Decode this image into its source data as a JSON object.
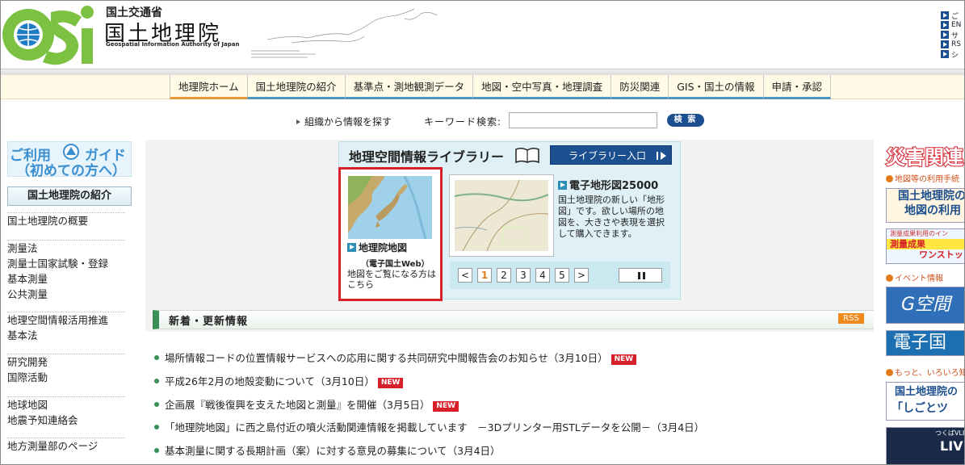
{
  "header": {
    "ministry": "国土交通省",
    "org_name": "国土地理院",
    "org_name_en": "Geospatial Information Authority of Japan",
    "logo_text": "GSI",
    "top_links": [
      "ご",
      "EN",
      "サ",
      "RS",
      "シ"
    ]
  },
  "gnav": {
    "items": [
      "地理院ホーム",
      "国土地理院の紹介",
      "基準点・測地観測データ",
      "地図・空中写真・地理調査",
      "防災関連",
      "GIS・国土の情報",
      "申請・承認"
    ]
  },
  "search": {
    "org_link": "組織から情報を探す",
    "keyword_label": "キーワード検索:",
    "keyword_value": "",
    "button": "検 索"
  },
  "sidebar": {
    "guide_line1_left": "ご利用",
    "guide_line1_right": "ガイド",
    "guide_line2": "（初めての方へ）",
    "section_title": "国土地理院の紹介",
    "groups": [
      [
        "国土地理院の概要"
      ],
      [
        "測量法",
        "測量士国家試験・登録",
        "基本測量",
        "公共測量"
      ],
      [
        "地理空間情報活用推進",
        "基本法"
      ],
      [
        "研究開発",
        "国際活動"
      ],
      [
        "地球地図",
        "地震予知連絡会"
      ],
      [
        "地方測量部のページ"
      ]
    ]
  },
  "library": {
    "title": "地理空間情報ライブラリー",
    "entry_button": "ライブラリー入口",
    "card1_title": "地理院地図",
    "card1_sub": "（電子国土Web）",
    "card1_desc": "地図をご覧になる方はこちら",
    "card2_title": "電子地形図25000",
    "card2_desc": "国土地理院の新しい「地形図」です。欲しい場所の地図を、大きさや表現を選択して購入できます。",
    "pager": [
      "<",
      "1",
      "2",
      "3",
      "4",
      "5",
      ">"
    ],
    "current_page": "1"
  },
  "news": {
    "title": "新着・更新情報",
    "rss": "RSS",
    "new_label": "NEW",
    "items": [
      {
        "text": "場所情報コードの位置情報サービスへの応用に関する共同研究中間報告会のお知らせ（3月10日）",
        "new": true
      },
      {
        "text": "平成26年2月の地殻変動について（3月10日）",
        "new": true
      },
      {
        "text": "企画展『戦後復興を支えた地図と測量』を開催（3月5日）",
        "new": true
      },
      {
        "text": "「地理院地図」に西之島付近の噴火活動関連情報を掲載しています　－3Dプリンター用STLデータを公開－（3月4日）",
        "new": false
      },
      {
        "text": "基本測量に関する長期計画（案）に対する意見の募集について（3月4日）",
        "new": false
      }
    ]
  },
  "right": {
    "disaster": "災害関連",
    "label1": "地図等の利用手続",
    "banner1_l1": "国土地理院の",
    "banner1_l2": "地図の利用",
    "banner2_l1": "測量成果利用のイン",
    "banner2_l2": "測量成果",
    "banner2_l3": "ワンストップ",
    "label2": "イベント情報",
    "banner3": "G空間",
    "banner4": "電子国",
    "label3": "もっと、いろいろ知",
    "banner5_l1": "国土地理院の",
    "banner5_l2": "「しごとツ",
    "banner6_l1": "つくばVLB",
    "banner6_l2": "LIV"
  }
}
